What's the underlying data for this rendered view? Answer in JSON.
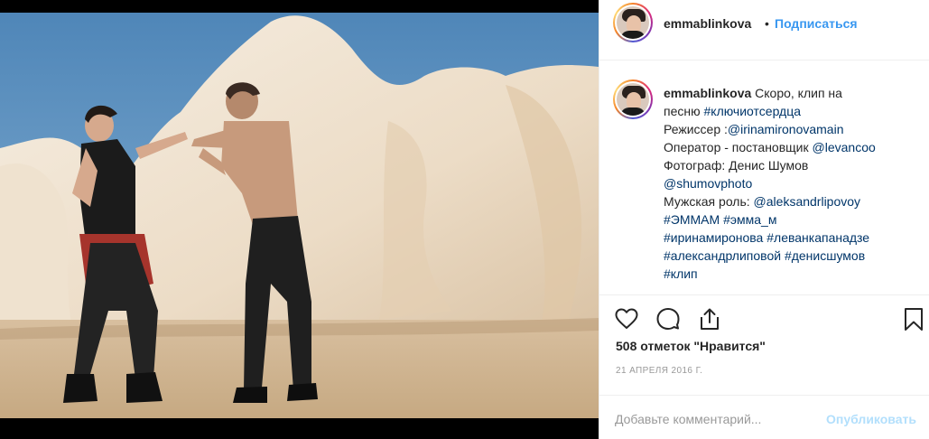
{
  "post": {
    "username": "emmablinkova",
    "separator": "•",
    "follow_label": "Подписаться"
  },
  "caption": {
    "author": "emmablinkova",
    "lines": [
      {
        "text": "Скоро, клип на",
        "tags": []
      },
      {
        "text": "песню ",
        "tags": [
          "#ключиотсердца"
        ]
      },
      {
        "text": "Режиссер :",
        "tags": [
          "@irinamironovamain"
        ]
      },
      {
        "text": "Оператор - постановщик ",
        "tags": [
          "@levancoo"
        ]
      },
      {
        "text": "Фотограф: Денис Шумов",
        "tags": []
      },
      {
        "text": "",
        "tags": [
          "@shumovphoto"
        ]
      },
      {
        "text": "Мужская роль: ",
        "tags": [
          "@aleksandrlipovoy"
        ]
      },
      {
        "text": "",
        "tags": [
          "#ЭММАМ",
          "#эмма_м"
        ]
      },
      {
        "text": "",
        "tags": [
          "#иринамиронова",
          "#леванкапанадзе"
        ]
      },
      {
        "text": "",
        "tags": [
          "#александрлиповой",
          "#денисшумов"
        ]
      },
      {
        "text": "",
        "tags": [
          "#клип"
        ]
      }
    ]
  },
  "actions": {
    "icons": [
      "heart-icon",
      "comment-icon",
      "share-icon",
      "bookmark-icon"
    ]
  },
  "likes_label": "508 отметок \"Нравится\"",
  "date_label": "21 АПРЕЛЯ 2016 Г.",
  "comment": {
    "placeholder": "Добавьте комментарий...",
    "publish_label": "Опубликовать"
  },
  "colors": {
    "link": "#003569",
    "accent": "#3897f0",
    "publish_disabled": "#b2dffc",
    "muted": "#999999",
    "sky": "#6a9bc3",
    "rock": "#f1e6d6"
  }
}
